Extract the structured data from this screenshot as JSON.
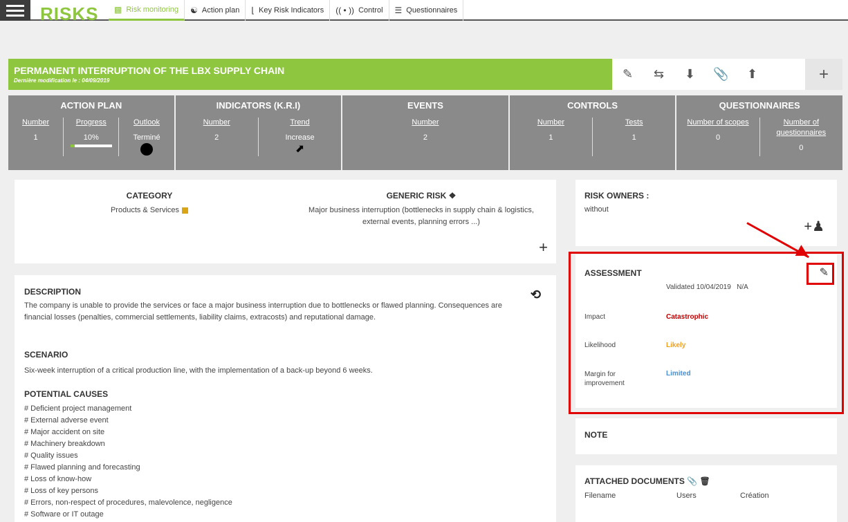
{
  "app": {
    "title": "RISKS"
  },
  "nav": {
    "tabs": [
      {
        "label": "Risk monitoring",
        "icon": "chart-icon",
        "active": true
      },
      {
        "label": "Action plan",
        "icon": "network-icon",
        "active": false
      },
      {
        "label": "Key Risk Indicators",
        "icon": "thermometer-icon",
        "active": false
      },
      {
        "label": "Control",
        "icon": "signal-icon",
        "active": false
      },
      {
        "label": "Questionnaires",
        "icon": "list-icon",
        "active": false
      }
    ]
  },
  "risk": {
    "title": "PERMANENT INTERRUPTION OF THE LBX SUPPLY CHAIN",
    "modified": "Dernière modification le : 04/09/2019"
  },
  "stats": {
    "action_plan": {
      "title": "ACTION PLAN",
      "number_label": "Number",
      "number": "1",
      "progress_label": "Progress",
      "progress": "10%",
      "progress_fraction": 0.1,
      "outlook_label": "Outlook",
      "outlook": "Terminé"
    },
    "indicators": {
      "title": "INDICATORS (K.R.I)",
      "number_label": "Number",
      "number": "2",
      "trend_label": "Trend",
      "trend": "Increase"
    },
    "events": {
      "title": "EVENTS",
      "number_label": "Number",
      "number": "2"
    },
    "controls": {
      "title": "CONTROLS",
      "number_label": "Number",
      "number": "1",
      "tests_label": "Tests",
      "tests": "1"
    },
    "questionnaires": {
      "title": "QUESTIONNAIRES",
      "scopes_label": "Number of scopes",
      "scopes": "0",
      "quest_label": "Number of questionnaires",
      "quest": "0"
    }
  },
  "category": {
    "heading": "CATEGORY",
    "value": "Products & Services"
  },
  "generic_risk": {
    "heading": "GENERIC RISK",
    "value": "Major business interruption (bottlenecks in supply chain & logistics, external events, planning errors ...)"
  },
  "description": {
    "heading": "DESCRIPTION",
    "text": "The company is unable to provide the services or face a major business interruption due to bottlenecks or flawed planning. Consequences are financial losses (penalties, commercial settlements, liability claims, extracosts) and reputational damage."
  },
  "scenario": {
    "heading": "SCENARIO",
    "text": "Six-week interruption of a critical production line, with the implementation of a back-up beyond 6 weeks."
  },
  "causes": {
    "heading": "POTENTIAL CAUSES",
    "items": [
      "# Deficient project management",
      "# External adverse event",
      "# Major accident on site",
      "# Machinery breakdown",
      "# Quality issues",
      "# Flawed planning and forecasting",
      "# Loss of know-how",
      "# Loss of key persons",
      "# Errors, non-respect of procedures, malevolence, negligence",
      "# Software or IT outage"
    ]
  },
  "owners": {
    "heading": "RISK OWNERS :",
    "value": "without"
  },
  "assessment": {
    "heading": "ASSESSMENT",
    "validated": "Validated 10/04/2019",
    "na": "N/A",
    "impact_label": "Impact",
    "impact": "Catastrophic",
    "impact_color": "#c00000",
    "likelihood_label": "Likelihood",
    "likelihood": "Likely",
    "likelihood_color": "#f0a020",
    "margin_label": "Margin for improvement",
    "margin": "Limited",
    "margin_color": "#4a8fd0"
  },
  "note": {
    "heading": "NOTE"
  },
  "docs": {
    "heading": "ATTACHED DOCUMENTS",
    "col_filename": "Filename",
    "col_users": "Users",
    "col_creation": "Création"
  },
  "colors": {
    "accent": "#8ec63f",
    "stats_bg": "#8a8a8a",
    "annotation": "#e00000"
  }
}
